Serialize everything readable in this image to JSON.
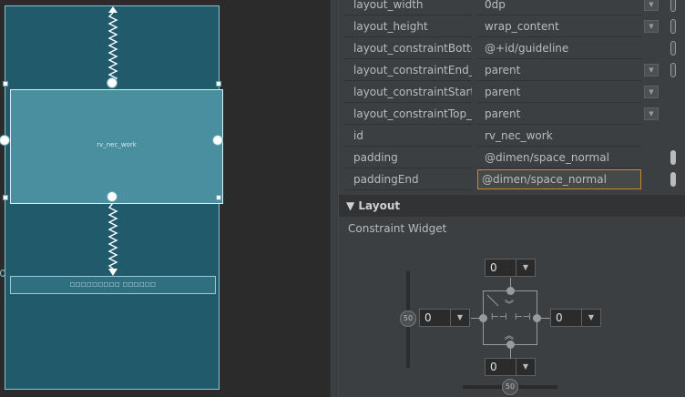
{
  "canvas": {
    "recycler_label": "rv_nec_work",
    "guideline_label": "□□□□□□□□□ □□□□□□"
  },
  "attributes": [
    {
      "name": "layout_width",
      "value": "0dp",
      "dropdown": true,
      "pill": "outline"
    },
    {
      "name": "layout_height",
      "value": "wrap_content",
      "dropdown": true,
      "pill": "outline"
    },
    {
      "name": "layout_constraintBottom_t",
      "value": "@+id/guideline",
      "dropdown": false,
      "pill": "outline"
    },
    {
      "name": "layout_constraintEnd_toEr",
      "value": "parent",
      "dropdown": true,
      "pill": "outline"
    },
    {
      "name": "layout_constraintStart_toS",
      "value": "parent",
      "dropdown": true,
      "pill": "none"
    },
    {
      "name": "layout_constraintTop_toTo",
      "value": "parent",
      "dropdown": true,
      "pill": "none"
    },
    {
      "name": "id",
      "value": "rv_nec_work",
      "dropdown": false,
      "pill": "none"
    },
    {
      "name": "padding",
      "value": "@dimen/space_normal",
      "dropdown": false,
      "pill": "filled"
    },
    {
      "name": "paddingEnd",
      "value": "@dimen/space_normal",
      "dropdown": false,
      "pill": "filled",
      "focused": true
    }
  ],
  "layout_section": {
    "title": "▼ Layout",
    "subtitle": "Constraint Widget",
    "margin_top": "0",
    "margin_left": "0",
    "margin_right": "0",
    "margin_bottom": "0",
    "vertical_bias": "50",
    "horizontal_bias": "50"
  },
  "colors": {
    "device_bg": "#215a6b",
    "selected_view": "#4a8fa0",
    "panel_bg": "#3c3f41",
    "focus_border": "#c58b2c"
  }
}
